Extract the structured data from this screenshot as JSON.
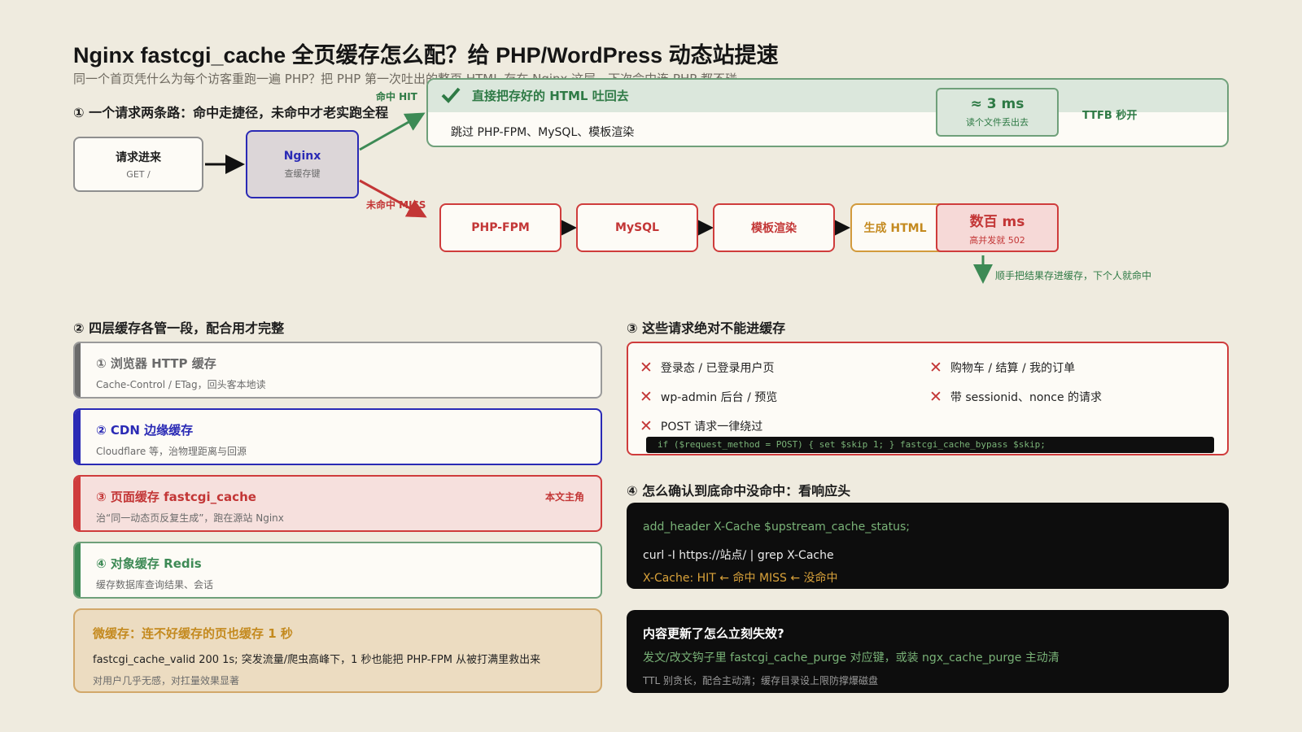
{
  "header": {
    "title": "Nginx fastcgi_cache 全页缓存怎么配？给 PHP/WordPress 动态站提速",
    "subtitle": "同一个首页凭什么为每个访客重跑一遍 PHP？把 PHP 第一次吐出的整页 HTML 存在 Nginx 这层，下次命中连 PHP 都不碰"
  },
  "flow": {
    "section_title": "① 一个请求两条路：命中走捷径，未命中才老实跑全程",
    "request": {
      "title": "请求进来",
      "sub": "GET /"
    },
    "nginx": {
      "title": "Nginx",
      "sub": "查缓存键"
    },
    "hit_label": "命中 HIT",
    "miss_label": "未命中 MISS",
    "hit": {
      "headline": "直接把存好的 HTML 吐回去",
      "desc": "跳过 PHP-FPM、MySQL、模板渲染",
      "metric": "≈ 3 ms",
      "metric_sub": "读个文件丢出去",
      "ttfb": "TTFB 秒开"
    },
    "miss_steps": [
      "PHP-FPM",
      "MySQL",
      "模板渲染"
    ],
    "generate": "生成 HTML",
    "miss_metric": "数百 ms",
    "miss_metric_sub": "高并发就 502",
    "store_note": "顺手把结果存进缓存，下个人就命中"
  },
  "layers": {
    "section_title": "② 四层缓存各管一段，配合用才完整",
    "items": [
      {
        "title": "① 浏览器 HTTP 缓存",
        "desc": "Cache-Control / ETag，回头客本地读",
        "tag": ""
      },
      {
        "title": "② CDN 边缘缓存",
        "desc": "Cloudflare 等，治物理距离与回源",
        "tag": ""
      },
      {
        "title": "③ 页面缓存 fastcgi_cache",
        "desc": "治“同一动态页反复生成”，跑在源站 Nginx",
        "tag": "本文主角"
      },
      {
        "title": "④ 对象缓存 Redis",
        "desc": "缓存数据库查询结果、会话",
        "tag": ""
      }
    ],
    "colors": [
      "#6a6a6a",
      "#2a2ab5",
      "#cf3c3c",
      "#3d8a55"
    ],
    "micro": {
      "title": "微缓存：连不好缓存的页也缓存 1 秒",
      "body": "fastcgi_cache_valid 200 1s; 突发流量/爬虫高峰下，1 秒也能把 PHP-FPM 从被打满里救出来",
      "note": "对用户几乎无感，对扛量效果显著"
    }
  },
  "nocache": {
    "section_title": "③ 这些请求绝对不能进缓存",
    "items": [
      "登录态 / 已登录用户页",
      "购物车 / 结算 / 我的订单",
      "wp-admin 后台 / 预览",
      "带 sessionid、nonce 的请求",
      "POST 请求一律绕过"
    ],
    "code": "if ($request_method = POST) { set $skip 1; }  fastcgi_cache_bypass $skip;"
  },
  "verify": {
    "section_title": "④ 怎么确认到底命中没命中：看响应头",
    "line1": "add_header X-Cache $upstream_cache_status;",
    "line2": "curl -I https://站点/ | grep X-Cache",
    "line3": "X-Cache: HIT  ← 命中    MISS ← 没命中"
  },
  "purge": {
    "title": "内容更新了怎么立刻失效?",
    "line1": "发文/改文钩子里 fastcgi_cache_purge 对应键，或装 ngx_cache_purge 主动清",
    "line2": "TTL 别贪长，配合主动清；缓存目录设上限防撑爆磁盘"
  }
}
